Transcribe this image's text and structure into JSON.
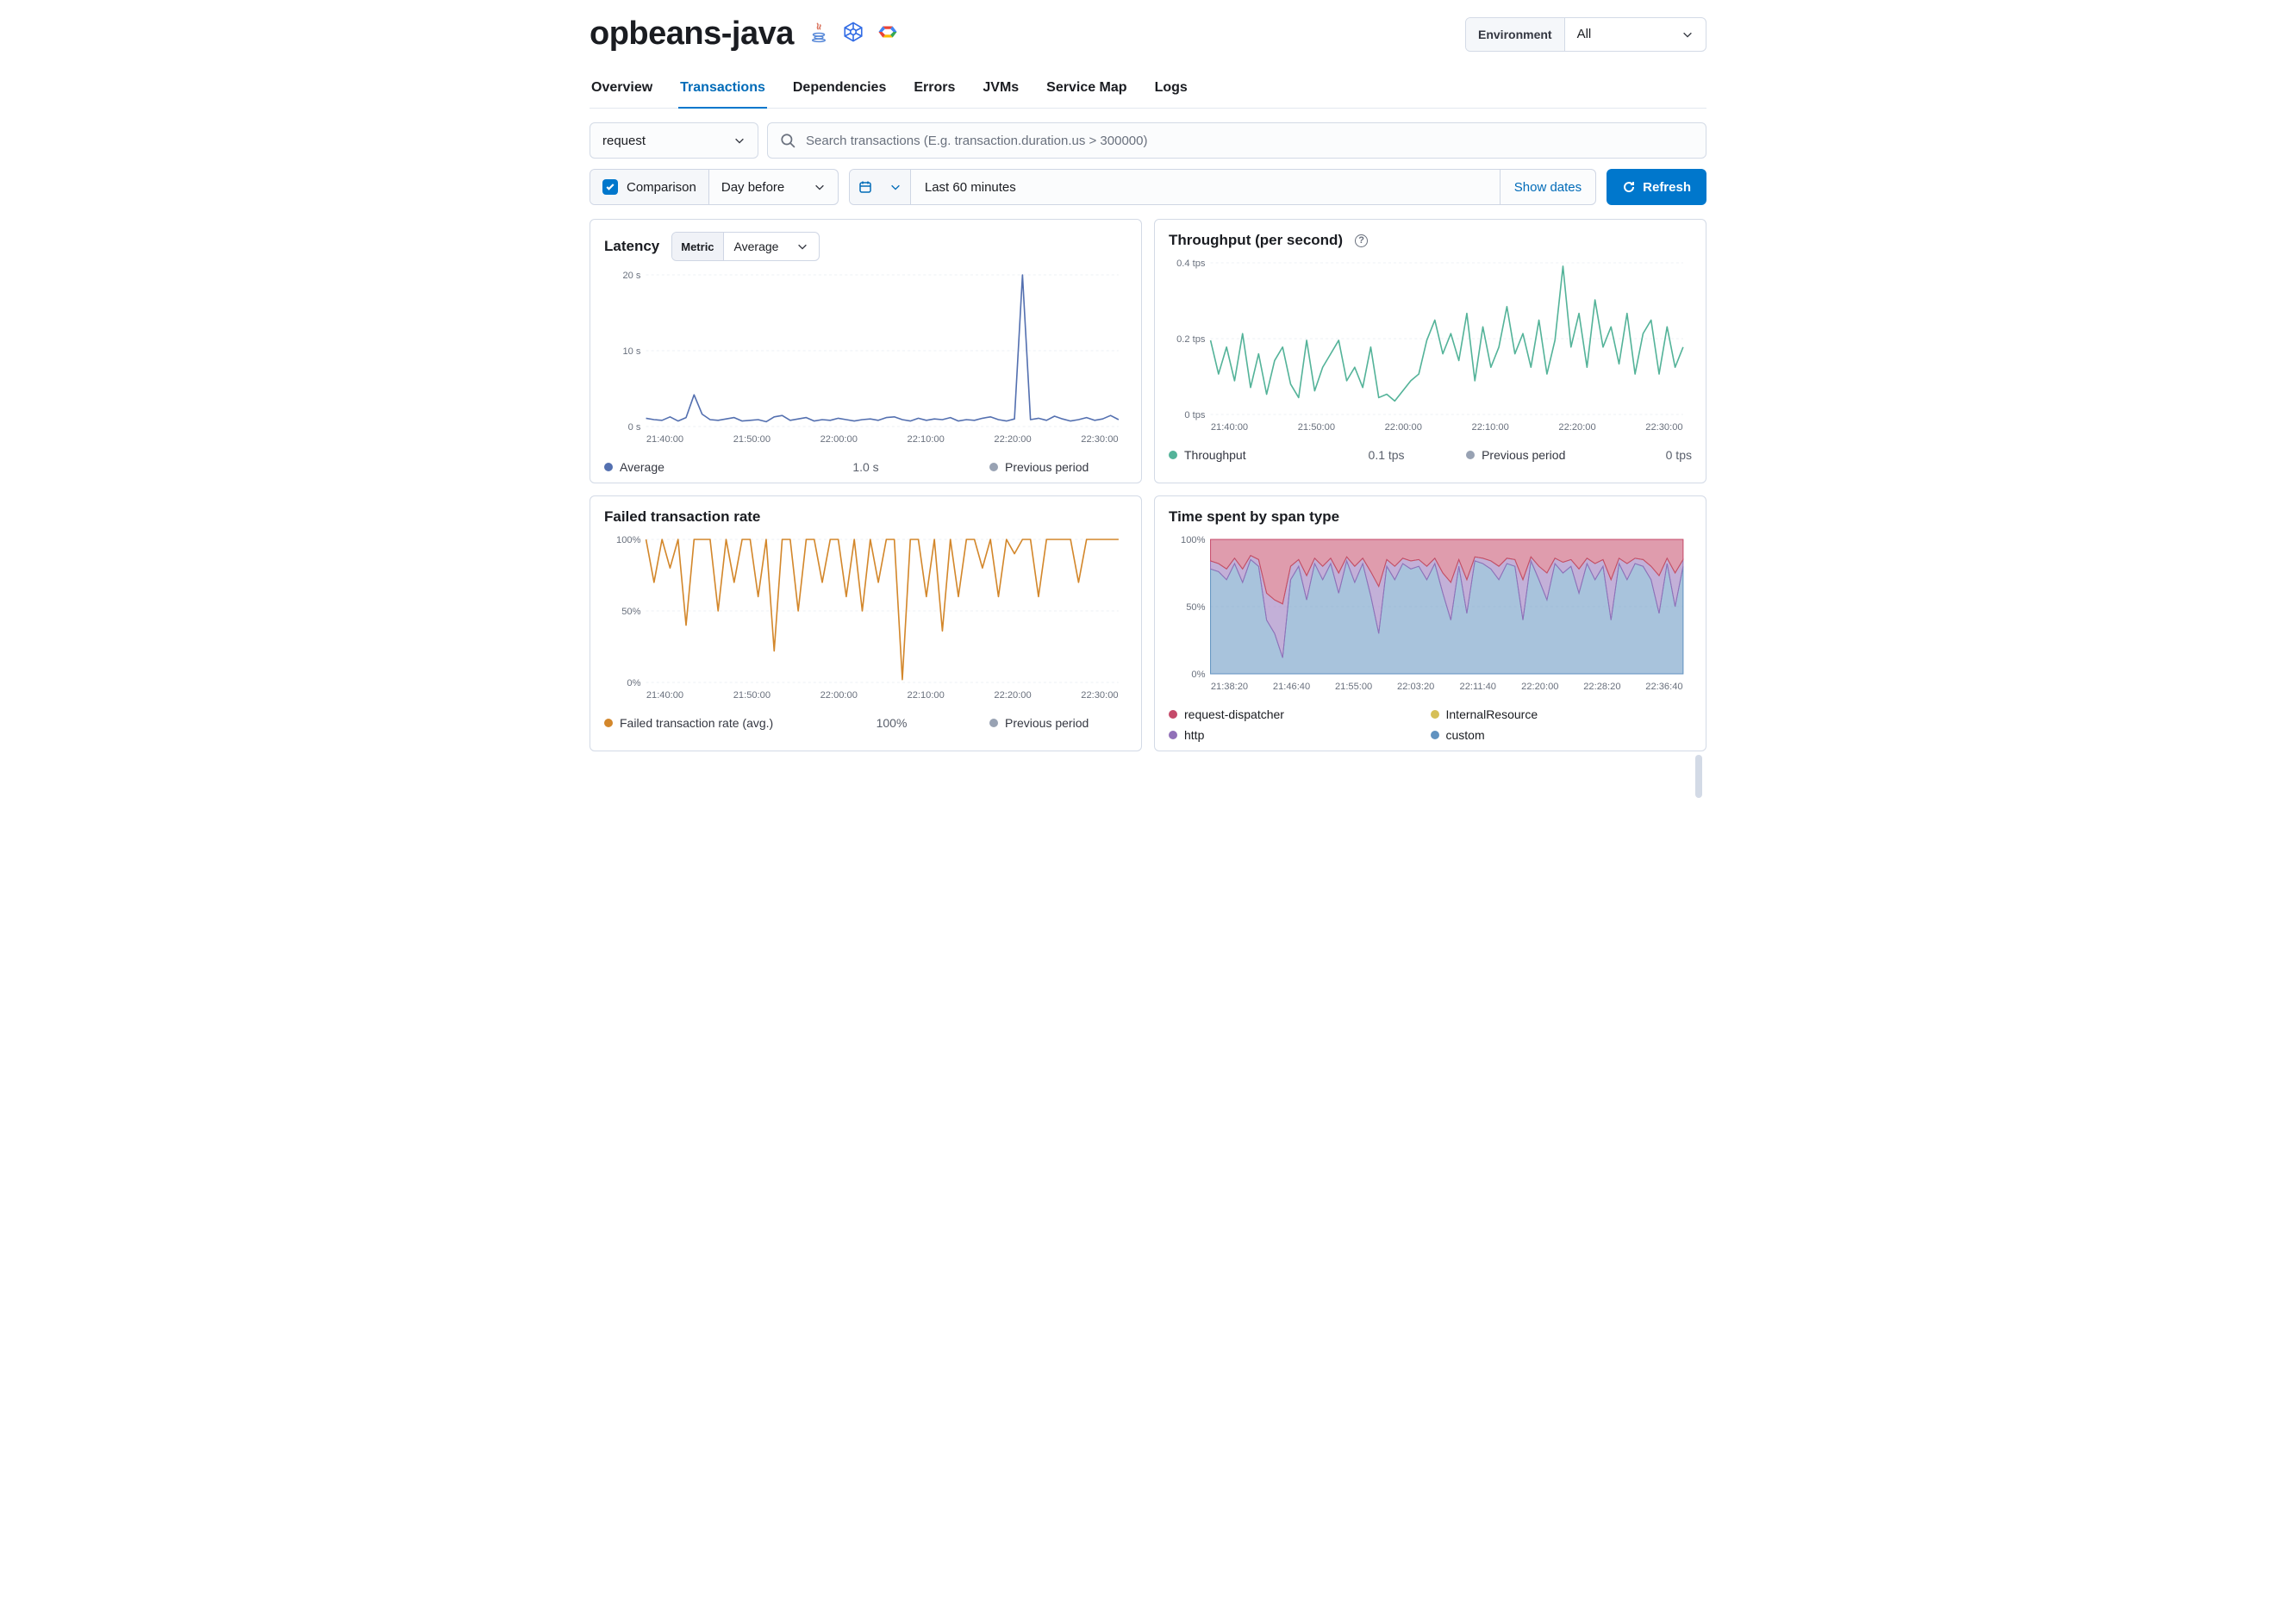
{
  "header": {
    "title": "opbeans-java",
    "icons": [
      "java-icon",
      "kubernetes-icon",
      "gcp-icon"
    ],
    "env_label": "Environment",
    "env_value": "All"
  },
  "tabs": [
    {
      "id": "overview",
      "label": "Overview",
      "active": false
    },
    {
      "id": "transactions",
      "label": "Transactions",
      "active": true
    },
    {
      "id": "dependencies",
      "label": "Dependencies",
      "active": false
    },
    {
      "id": "errors",
      "label": "Errors",
      "active": false
    },
    {
      "id": "jvms",
      "label": "JVMs",
      "active": false
    },
    {
      "id": "service-map",
      "label": "Service Map",
      "active": false
    },
    {
      "id": "logs",
      "label": "Logs",
      "active": false
    }
  ],
  "filters": {
    "type_select": "request",
    "search_placeholder": "Search transactions (E.g. transaction.duration.us > 300000)"
  },
  "toolbar": {
    "comparison_label": "Comparison",
    "comparison_checked": true,
    "comparison_select": "Day before",
    "timerange_label": "Last 60 minutes",
    "show_dates": "Show dates",
    "refresh": "Refresh"
  },
  "panels": {
    "latency": {
      "title": "Latency",
      "metric_label": "Metric",
      "metric_value": "Average",
      "legend": [
        {
          "name": "Average",
          "color": "#5470b0",
          "value": "1.0 s"
        },
        {
          "name": "Previous period",
          "color": "#98a2b3",
          "value": ""
        }
      ]
    },
    "throughput": {
      "title": "Throughput (per second)",
      "legend": [
        {
          "name": "Throughput",
          "color": "#54b399",
          "value": "0.1 tps"
        },
        {
          "name": "Previous period",
          "color": "#98a2b3",
          "value": "0 tps"
        }
      ]
    },
    "failed": {
      "title": "Failed transaction rate",
      "legend": [
        {
          "name": "Failed transaction rate (avg.)",
          "color": "#d3872b",
          "value": "100%"
        },
        {
          "name": "Previous period",
          "color": "#98a2b3",
          "value": ""
        }
      ]
    },
    "spans": {
      "title": "Time spent by span type",
      "legend": [
        {
          "name": "request-dispatcher",
          "color": "#c54a6a"
        },
        {
          "name": "InternalResource",
          "color": "#d6bf57"
        },
        {
          "name": "http",
          "color": "#9170b8"
        },
        {
          "name": "custom",
          "color": "#6092c0"
        }
      ]
    }
  },
  "chart_data": [
    {
      "id": "latency",
      "type": "line",
      "title": "Latency",
      "ylabel": "seconds",
      "ylim": [
        0,
        22
      ],
      "y_ticks": [
        "0 s",
        "10 s",
        "20 s"
      ],
      "x_ticks": [
        "21:40:00",
        "21:50:00",
        "22:00:00",
        "22:10:00",
        "22:20:00",
        "22:30:00"
      ],
      "series": [
        {
          "name": "Average",
          "color": "#5470b0",
          "values": [
            1.2,
            1.0,
            0.9,
            1.4,
            0.8,
            1.3,
            4.6,
            1.8,
            1.0,
            0.9,
            1.1,
            1.3,
            0.8,
            0.9,
            1.0,
            0.7,
            1.4,
            1.6,
            0.9,
            1.1,
            1.3,
            0.8,
            1.0,
            0.9,
            1.2,
            1.0,
            0.8,
            1.0,
            1.1,
            0.9,
            1.3,
            1.4,
            1.0,
            0.8,
            1.2,
            0.9,
            1.1,
            1.0,
            1.3,
            0.8,
            1.0,
            0.9,
            1.2,
            1.4,
            1.0,
            0.8,
            1.1,
            22.0,
            1.0,
            1.2,
            0.9,
            1.5,
            1.1,
            0.8,
            1.0,
            1.3,
            0.9,
            1.1,
            1.6,
            1.0
          ]
        }
      ]
    },
    {
      "id": "throughput",
      "type": "line",
      "title": "Throughput (per second)",
      "ylabel": "tps",
      "ylim": [
        0,
        0.45
      ],
      "y_ticks": [
        "0 tps",
        "0.2 tps",
        "0.4 tps"
      ],
      "x_ticks": [
        "21:40:00",
        "21:50:00",
        "22:00:00",
        "22:10:00",
        "22:20:00",
        "22:30:00"
      ],
      "series": [
        {
          "name": "Throughput",
          "color": "#54b399",
          "values": [
            0.22,
            0.12,
            0.2,
            0.1,
            0.24,
            0.08,
            0.18,
            0.06,
            0.16,
            0.2,
            0.09,
            0.05,
            0.22,
            0.07,
            0.14,
            0.18,
            0.22,
            0.1,
            0.14,
            0.08,
            0.2,
            0.05,
            0.06,
            0.04,
            0.07,
            0.1,
            0.12,
            0.22,
            0.28,
            0.18,
            0.24,
            0.16,
            0.3,
            0.1,
            0.26,
            0.14,
            0.2,
            0.32,
            0.18,
            0.24,
            0.14,
            0.28,
            0.12,
            0.22,
            0.44,
            0.2,
            0.3,
            0.14,
            0.34,
            0.2,
            0.26,
            0.15,
            0.3,
            0.12,
            0.24,
            0.28,
            0.12,
            0.26,
            0.14,
            0.2
          ]
        }
      ]
    },
    {
      "id": "failed",
      "type": "line",
      "title": "Failed transaction rate",
      "ylabel": "%",
      "ylim": [
        0,
        100
      ],
      "y_ticks": [
        "0%",
        "50%",
        "100%"
      ],
      "x_ticks": [
        "21:40:00",
        "21:50:00",
        "22:00:00",
        "22:10:00",
        "22:20:00",
        "22:30:00"
      ],
      "series": [
        {
          "name": "Failed transaction rate (avg.)",
          "color": "#d3872b",
          "values": [
            100,
            70,
            100,
            80,
            100,
            40,
            100,
            100,
            100,
            50,
            100,
            70,
            100,
            100,
            60,
            100,
            22,
            100,
            100,
            50,
            100,
            100,
            70,
            100,
            100,
            60,
            100,
            50,
            100,
            70,
            100,
            100,
            2,
            100,
            100,
            60,
            100,
            36,
            100,
            60,
            100,
            100,
            80,
            100,
            60,
            100,
            90,
            100,
            100,
            60,
            100,
            100,
            100,
            100,
            70,
            100,
            100,
            100,
            100,
            100
          ]
        }
      ]
    },
    {
      "id": "spans",
      "type": "area",
      "title": "Time spent by span type",
      "ylabel": "%",
      "ylim": [
        0,
        100
      ],
      "y_ticks": [
        "0%",
        "50%",
        "100%"
      ],
      "x_ticks": [
        "21:38:20",
        "21:46:40",
        "21:55:00",
        "22:03:20",
        "22:11:40",
        "22:20:00",
        "22:28:20",
        "22:36:40"
      ],
      "stacked": true,
      "series": [
        {
          "name": "custom",
          "color": "#6092c0",
          "values": [
            78,
            76,
            70,
            82,
            68,
            85,
            80,
            40,
            30,
            12,
            70,
            80,
            55,
            82,
            70,
            82,
            60,
            84,
            68,
            82,
            58,
            30,
            80,
            70,
            82,
            78,
            80,
            70,
            82,
            60,
            40,
            80,
            45,
            84,
            82,
            78,
            70,
            82,
            80,
            40,
            84,
            70,
            55,
            82,
            75,
            80,
            60,
            82,
            70,
            80,
            40,
            82,
            70,
            82,
            80,
            70,
            45,
            82,
            50,
            80
          ]
        },
        {
          "name": "http",
          "color": "#9170b8",
          "values": [
            6,
            6,
            8,
            4,
            10,
            3,
            5,
            20,
            25,
            40,
            10,
            5,
            18,
            4,
            10,
            4,
            15,
            3,
            12,
            4,
            18,
            35,
            5,
            10,
            4,
            6,
            5,
            10,
            4,
            15,
            28,
            5,
            25,
            3,
            4,
            6,
            10,
            4,
            5,
            30,
            3,
            10,
            20,
            4,
            8,
            5,
            18,
            4,
            12,
            5,
            30,
            4,
            12,
            4,
            5,
            10,
            28,
            4,
            25,
            5
          ]
        },
        {
          "name": "InternalResource",
          "color": "#d6bf57",
          "values": [
            0,
            0,
            0,
            0,
            0,
            0,
            0,
            0,
            0,
            0,
            0,
            0,
            0,
            0,
            0,
            0,
            0,
            0,
            0,
            0,
            0,
            0,
            0,
            0,
            0,
            0,
            0,
            0,
            0,
            0,
            0,
            0,
            0,
            0,
            0,
            0,
            0,
            0,
            0,
            0,
            0,
            0,
            0,
            0,
            0,
            0,
            0,
            0,
            0,
            0,
            0,
            0,
            0,
            0,
            0,
            0,
            0,
            0,
            0,
            0
          ]
        },
        {
          "name": "request-dispatcher",
          "color": "#c54a6a",
          "values": [
            16,
            18,
            22,
            14,
            22,
            12,
            15,
            40,
            45,
            48,
            20,
            15,
            27,
            14,
            20,
            14,
            25,
            13,
            20,
            14,
            24,
            35,
            15,
            20,
            14,
            16,
            15,
            20,
            14,
            25,
            32,
            15,
            30,
            13,
            14,
            16,
            20,
            14,
            15,
            30,
            13,
            20,
            25,
            14,
            17,
            15,
            22,
            14,
            18,
            15,
            30,
            14,
            18,
            14,
            15,
            20,
            27,
            14,
            25,
            15
          ]
        }
      ]
    }
  ]
}
